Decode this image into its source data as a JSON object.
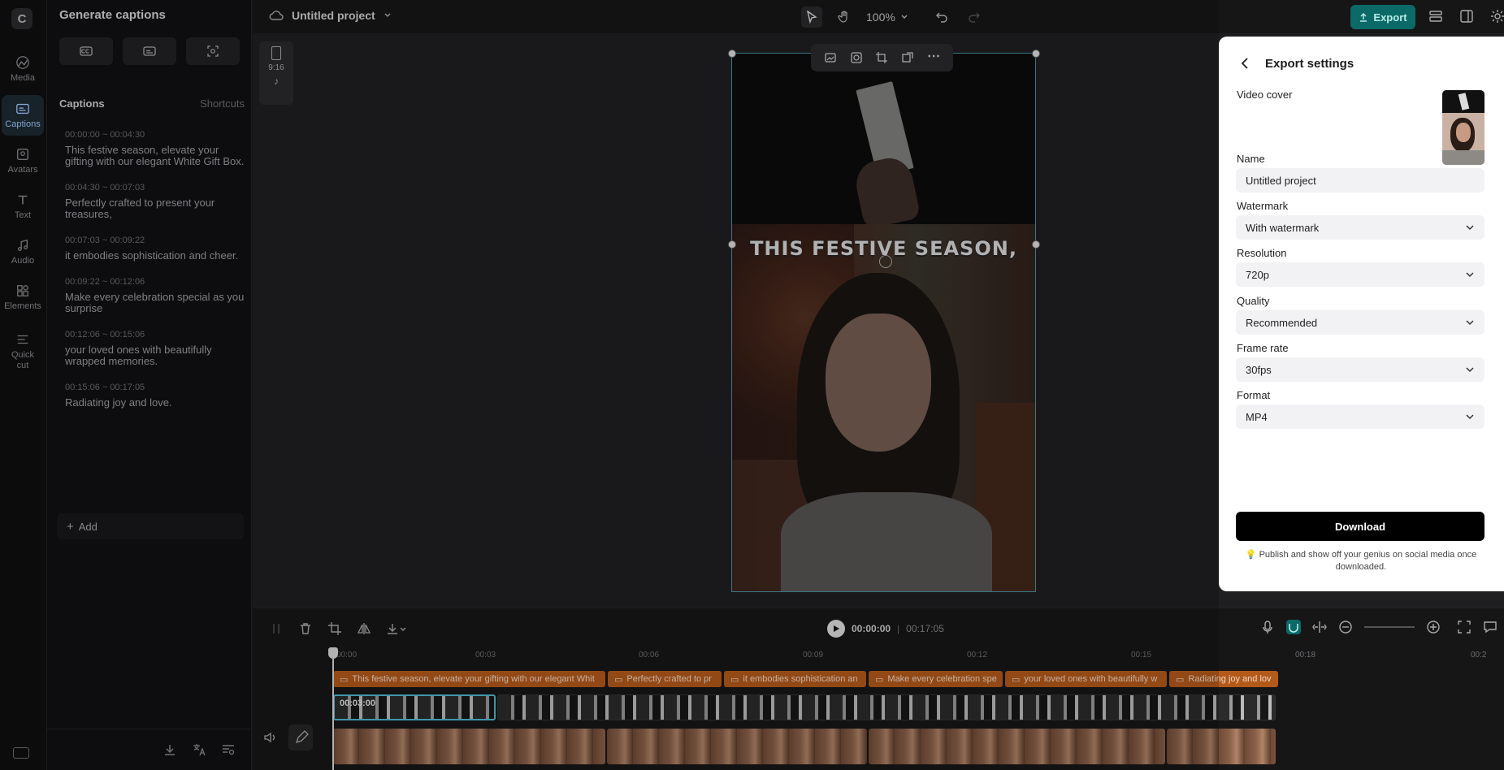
{
  "rail": {
    "items": [
      {
        "label": "Media",
        "icon": "media-icon"
      },
      {
        "label": "Captions",
        "icon": "captions-icon",
        "active": true
      },
      {
        "label": "Avatars",
        "icon": "avatars-icon"
      },
      {
        "label": "Text",
        "icon": "text-icon"
      },
      {
        "label": "Audio",
        "icon": "audio-icon"
      },
      {
        "label": "Elements",
        "icon": "elements-icon"
      },
      {
        "label": "Quick cut",
        "icon": "quick-cut-icon"
      }
    ]
  },
  "captions_panel": {
    "title": "Generate captions",
    "section_title": "Captions",
    "shortcuts_label": "Shortcuts",
    "items": [
      {
        "time": "00:00:00 ~ 00:04:30",
        "text": "This festive season, elevate your gifting with our elegant White Gift Box."
      },
      {
        "time": "00:04:30 ~ 00:07:03",
        "text": "Perfectly crafted to present your treasures,"
      },
      {
        "time": "00:07:03 ~ 00:09:22",
        "text": "it embodies sophistication and cheer."
      },
      {
        "time": "00:09:22 ~ 00:12:06",
        "text": "Make every celebration special as you surprise"
      },
      {
        "time": "00:12:06 ~ 00:15:06",
        "text": "your loved ones with beautifully wrapped memories."
      },
      {
        "time": "00:15:06 ~ 00:17:05",
        "text": "Radiating joy and love."
      }
    ],
    "add_label": "Add"
  },
  "topbar": {
    "project_name": "Untitled project",
    "zoom": "100%",
    "export_label": "Export"
  },
  "canvas": {
    "ratio": "9:16",
    "caption_overlay": "THIS FESTIVE SEASON,"
  },
  "export_settings": {
    "title": "Export settings",
    "video_cover_label": "Video cover",
    "name_label": "Name",
    "name_value": "Untitled project",
    "watermark_label": "Watermark",
    "watermark_value": "With watermark",
    "resolution_label": "Resolution",
    "resolution_value": "720p",
    "quality_label": "Quality",
    "quality_value": "Recommended",
    "frame_rate_label": "Frame rate",
    "frame_rate_value": "30fps",
    "format_label": "Format",
    "format_value": "MP4",
    "download_label": "Download",
    "note": "Publish and show off your genius on social media once downloaded."
  },
  "timeline": {
    "current_time": "00:00:00",
    "total_time": "00:17:05",
    "ruler": [
      "00:00",
      "00:03",
      "00:06",
      "00:09",
      "00:12",
      "00:15",
      "00:18",
      "00:2"
    ],
    "caption_clips": [
      "This festive season, elevate your gifting with our elegant Whit",
      "Perfectly crafted to pr",
      "it embodies sophistication an",
      "Make every celebration spe",
      "your loved ones with beautifully w",
      "Radiating joy and lov"
    ],
    "video_clip_time": "00:03:00"
  },
  "colors": {
    "accent": "#0b6a67",
    "caption_clip": "#b35a1a",
    "selection": "#4fb9d0"
  }
}
